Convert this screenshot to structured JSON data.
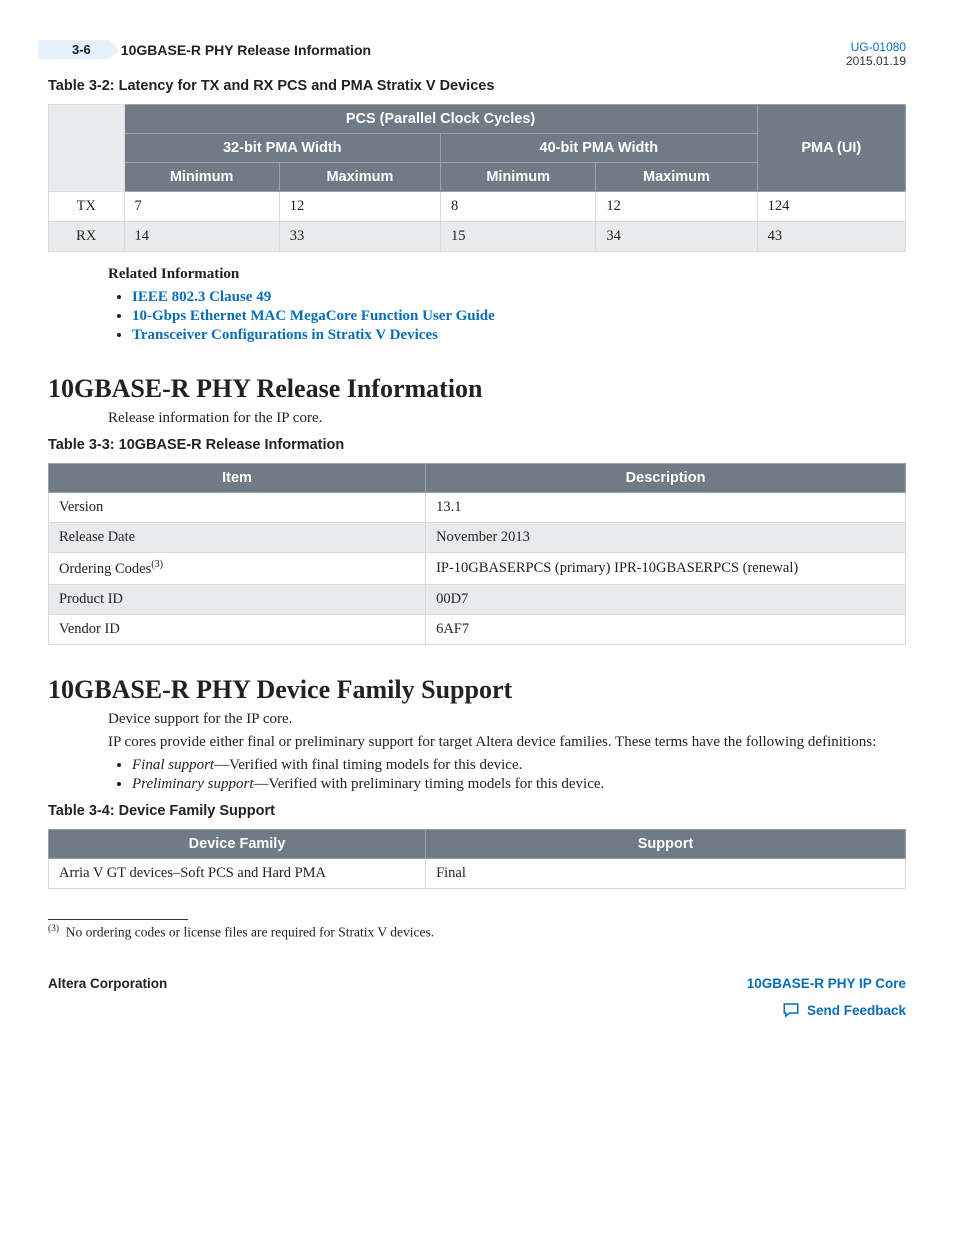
{
  "header": {
    "page_number": "3-6",
    "page_title": "10GBASE-R PHY Release Information",
    "doc_id": "UG-01080",
    "doc_date": "2015.01.19"
  },
  "table1": {
    "caption": "Table 3-2: Latency for TX and RX PCS and PMA Stratix V Devices",
    "head": {
      "pcs": "PCS (Parallel Clock Cycles)",
      "w32": "32-bit PMA Width",
      "w40": "40-bit PMA Width",
      "pma": "PMA (UI)",
      "min": "Minimum",
      "max": "Maximum"
    },
    "rows": [
      {
        "label": "TX",
        "w32min": "7",
        "w32max": "12",
        "w40min": "8",
        "w40max": "12",
        "pma": "124"
      },
      {
        "label": "RX",
        "w32min": "14",
        "w32max": "33",
        "w40min": "15",
        "w40max": "34",
        "pma": "43"
      }
    ]
  },
  "related": {
    "heading": "Related Information",
    "links": [
      "IEEE 802.3 Clause 49",
      "10-Gbps Ethernet MAC MegaCore Function User Guide",
      "Transceiver Configurations in Stratix V Devices"
    ]
  },
  "section1": {
    "heading": "10GBASE-R PHY Release Information",
    "intro": "Release information for the IP core.",
    "caption": "Table 3-3: 10GBASE-R Release Information",
    "head_item": "Item",
    "head_desc": "Description",
    "rows": [
      {
        "item": "Version",
        "desc": "13.1"
      },
      {
        "item": "Release Date",
        "desc": "November 2013"
      },
      {
        "item": "Ordering Codes",
        "sup": "(3)",
        "desc": "IP-10GBASERPCS (primary) IPR-10GBASERPCS (renewal)"
      },
      {
        "item": "Product ID",
        "desc": "00D7"
      },
      {
        "item": "Vendor ID",
        "desc": "6AF7"
      }
    ]
  },
  "section2": {
    "heading": "10GBASE-R PHY Device Family Support",
    "intro": "Device support for the IP core.",
    "para": "IP cores provide either final or preliminary support for target Altera device families. These terms have the following definitions:",
    "defs": [
      {
        "term": "Final support",
        "text": "—Verified with final timing models for this device."
      },
      {
        "term": "Preliminary support",
        "text": "—Verified with preliminary timing models for this device."
      }
    ],
    "caption": "Table 3-4: Device Family Support",
    "head_family": "Device Family",
    "head_support": "Support",
    "rows": [
      {
        "family": "Arria V GT devices–Soft PCS and Hard PMA",
        "support": "Final"
      }
    ]
  },
  "footnote": {
    "mark": "(3)",
    "text": "No ordering codes or license files are required for Stratix V devices."
  },
  "footer": {
    "left": "Altera Corporation",
    "right_link": "10GBASE-R PHY IP Core",
    "feedback": "Send Feedback"
  }
}
